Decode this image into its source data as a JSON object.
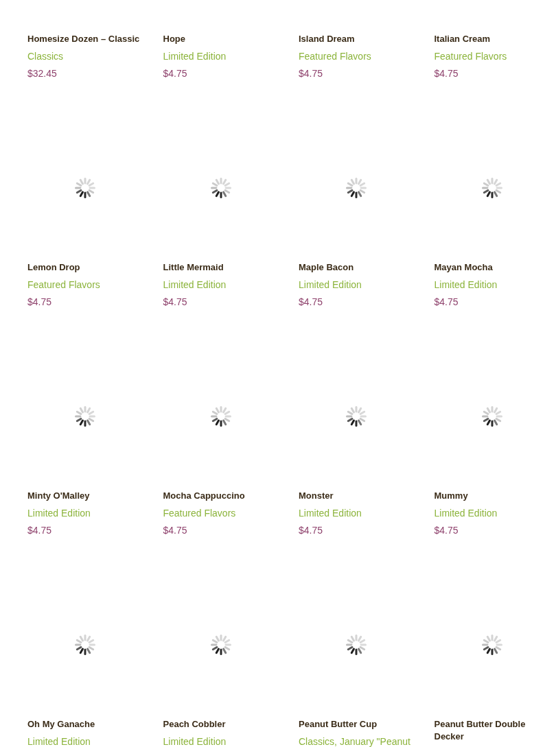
{
  "products": [
    {
      "name": "Homesize Dozen – Classic",
      "category": "Classics",
      "price": "$32.45"
    },
    {
      "name": "Hope",
      "category": "Limited Edition",
      "price": "$4.75"
    },
    {
      "name": "Island Dream",
      "category": "Featured Flavors",
      "price": "$4.75"
    },
    {
      "name": "Italian Cream",
      "category": "Featured Flavors",
      "price": "$4.75"
    },
    {
      "name": "Lemon Drop",
      "category": "Featured Flavors",
      "price": "$4.75",
      "image": {
        "loading": true
      }
    },
    {
      "name": "Little Mermaid",
      "category": "Limited Edition",
      "price": "$4.75",
      "image": {
        "loading": true
      }
    },
    {
      "name": "Maple Bacon",
      "category": "Limited Edition",
      "price": "$4.75",
      "image": {
        "loading": true
      }
    },
    {
      "name": "Mayan Mocha",
      "category": "Limited Edition",
      "price": "$4.75",
      "image": {
        "loading": true
      }
    },
    {
      "name": "Minty O'Malley",
      "category": "Limited Edition",
      "price": "$4.75",
      "image": {
        "loading": true
      }
    },
    {
      "name": "Mocha Cappuccino",
      "category": "Featured Flavors",
      "price": "$4.75",
      "image": {
        "loading": true
      }
    },
    {
      "name": "Monster",
      "category": "Limited Edition",
      "price": "$4.75",
      "image": {
        "loading": true
      }
    },
    {
      "name": "Mummy",
      "category": "Limited Edition",
      "price": "$4.75",
      "image": {
        "loading": true
      }
    },
    {
      "name": "Oh My Ganache",
      "category": "Limited Edition",
      "image": {
        "loading": true
      }
    },
    {
      "name": "Peach Cobbler",
      "category": "Limited Edition",
      "image": {
        "loading": true
      }
    },
    {
      "name": "Peanut Butter Cup",
      "category": "Classics, January \"Peanut",
      "image": {
        "loading": true
      }
    },
    {
      "name": "Peanut Butter Double Decker",
      "image": {
        "loading": true
      }
    }
  ]
}
